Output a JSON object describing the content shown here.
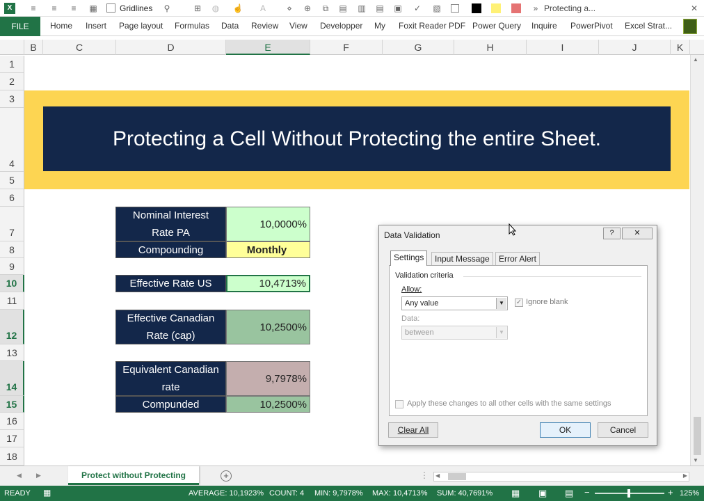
{
  "qat": {
    "gridlines_label": "Gridlines",
    "file_name": "Protecting a..."
  },
  "ribbon": {
    "file_tab": "FILE",
    "tabs": [
      "Home",
      "Insert",
      "Page layout",
      "Formulas",
      "Data",
      "Review",
      "View",
      "Developper",
      "My",
      "Foxit Reader PDF",
      "Power Query",
      "Inquire",
      "PowerPivot",
      "Excel Strat..."
    ]
  },
  "columns": [
    "B",
    "C",
    "D",
    "E",
    "F",
    "G",
    "H",
    "I",
    "J",
    "K"
  ],
  "rows": [
    "1",
    "2",
    "3",
    "4",
    "5",
    "6",
    "7",
    "8",
    "9",
    "10",
    "11",
    "12",
    "13",
    "14",
    "15",
    "16",
    "17",
    "18"
  ],
  "banner": "Protecting a Cell Without Protecting the entire Sheet.",
  "table": {
    "nominal_label": "Nominal Interest Rate PA",
    "nominal_value": "10,0000%",
    "compounding_label": "Compounding",
    "compounding_value": "Monthly",
    "eff_us_label": "Effective Rate US",
    "eff_us_value": "10,4713%",
    "eff_ca_label": "Effective Canadian Rate (cap)",
    "eff_ca_value": "10,2500%",
    "equiv_label": "Equivalent Canadian rate",
    "equiv_value": "9,7978%",
    "compunded_label": "Compunded",
    "compunded_value": "10,2500%"
  },
  "dialog": {
    "title": "Data Validation",
    "help": "?",
    "close": "✕",
    "tabs": [
      "Settings",
      "Input Message",
      "Error Alert"
    ],
    "section": "Validation criteria",
    "allow_label": "Allow:",
    "allow_value": "Any value",
    "ignore_blank": "Ignore blank",
    "data_label": "Data:",
    "data_value": "between",
    "apply_all": "Apply these changes to all other cells with the same settings",
    "clear_all": "Clear All",
    "ok": "OK",
    "cancel": "Cancel"
  },
  "sheet_tab": "Protect without Protecting",
  "status": {
    "ready": "READY",
    "average": "AVERAGE: 10,1923%",
    "count": "COUNT: 4",
    "min": "MIN: 9,7978%",
    "max": "MAX: 10,4713%",
    "sum": "SUM: 40,7691%",
    "zoom": "125%"
  },
  "colors": {
    "excel_green": "#217346",
    "navy": "#13274a",
    "gold": "#fdd552",
    "green_light": "#ccffcc",
    "green_mid": "#99c49f",
    "mauve": "#c4aeae",
    "yellow": "#ffff99"
  }
}
